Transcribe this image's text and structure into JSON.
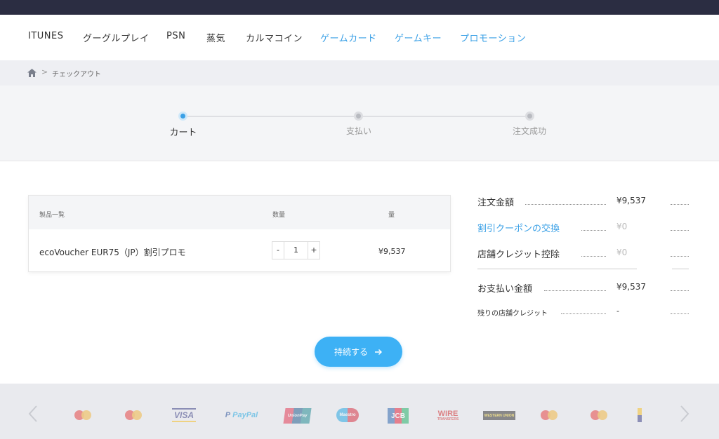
{
  "nav": {
    "items": [
      {
        "label": "ITUNES",
        "highlight": false
      },
      {
        "label": "グーグルプレイ",
        "highlight": false
      },
      {
        "label": "PSN",
        "highlight": false
      },
      {
        "label": "蒸気",
        "highlight": false
      },
      {
        "label": "カルマコイン",
        "highlight": false
      },
      {
        "label": "ゲームカード",
        "highlight": true
      },
      {
        "label": "ゲームキー",
        "highlight": true
      },
      {
        "label": "プロモーション",
        "highlight": true
      }
    ]
  },
  "breadcrumb": {
    "sep": ">",
    "current": "チェックアウト"
  },
  "steps": [
    {
      "label": "カート",
      "active": true
    },
    {
      "label": "支払い",
      "active": false
    },
    {
      "label": "注文成功",
      "active": false
    }
  ],
  "cart": {
    "headers": {
      "product": "製品一覧",
      "qty": "数量",
      "price": "量"
    },
    "item": {
      "name": "ecoVoucher EUR75（JP）割引プロモ",
      "minus": "-",
      "qty": "1",
      "plus": "+",
      "price": "¥9,537"
    }
  },
  "summary": {
    "order_total_label": "注文金額",
    "order_total_value": "¥9,537",
    "coupon_label": "割引クーポンの交換",
    "coupon_value": "¥0",
    "credit_label": "店舗クレジット控除",
    "credit_value": "¥0",
    "payment_label": "お支払い金額",
    "payment_value": "¥9,537",
    "remaining_label": "残りの店舗クレジット",
    "remaining_value": "-"
  },
  "continue_button": {
    "label": "持続する",
    "arrow": "→"
  },
  "payment_logos": {
    "visa": "VISA",
    "paypal_p": "P",
    "paypal": "PayPal",
    "unionpay": "UnionPay",
    "maestro": "Maestro",
    "jcb": "JCB",
    "wire": "WIRE",
    "wire_sub": "TRANSFERS",
    "western_union": "WESTERN UNION"
  },
  "colors": {
    "accent": "#3aa0e6",
    "button": "#3db1f5",
    "topbar": "#2b2d42"
  }
}
